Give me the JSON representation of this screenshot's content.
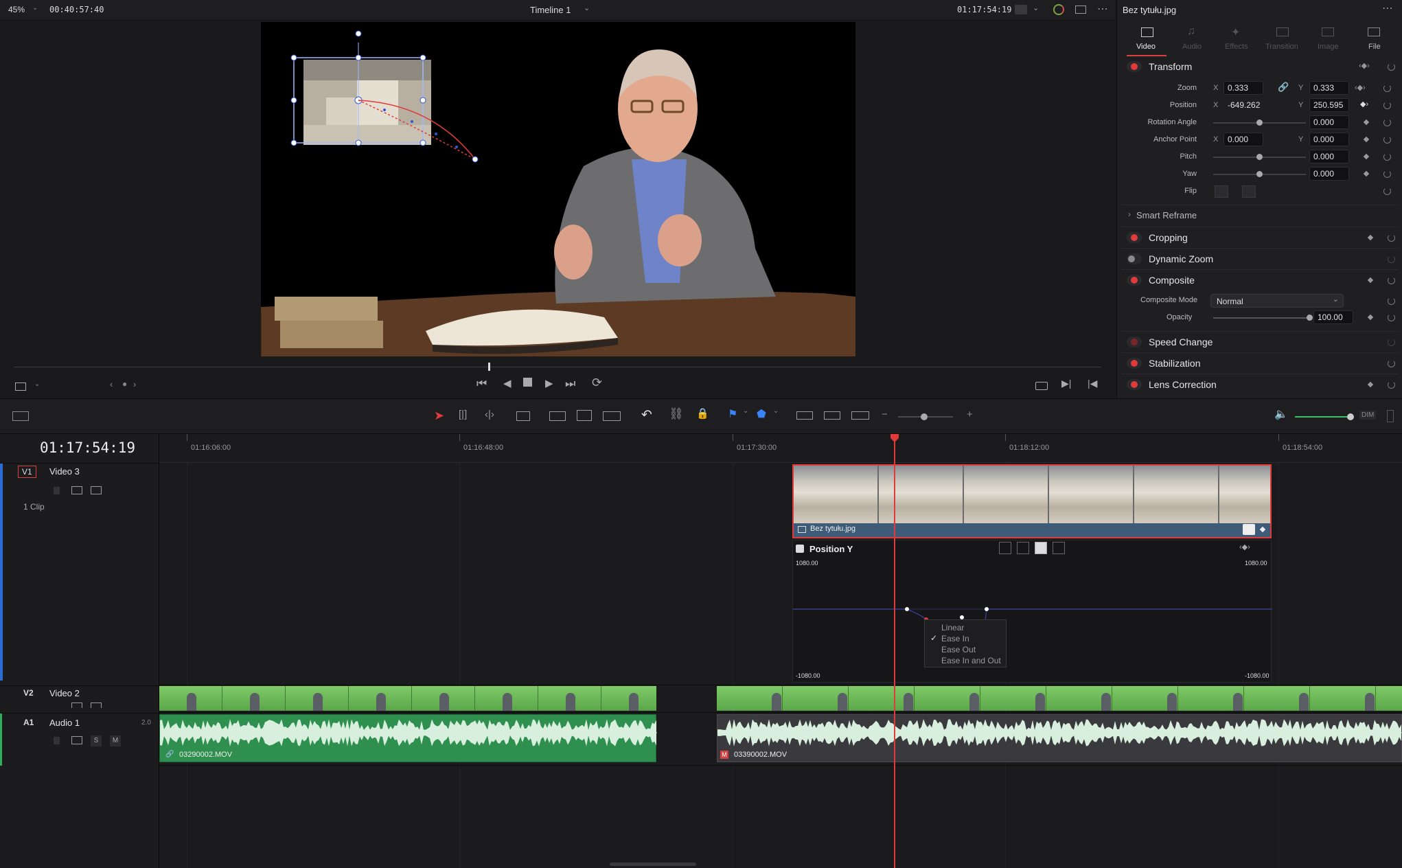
{
  "viewer": {
    "zoom": "45%",
    "source_timecode": "00:40:57:40",
    "timeline_name": "Timeline 1",
    "record_timecode": "01:17:54:19"
  },
  "inspector": {
    "clip_name": "Bez tytułu.jpg",
    "tabs": [
      {
        "label": "Video",
        "icon": "video-icon"
      },
      {
        "label": "Audio",
        "icon": "audio-icon"
      },
      {
        "label": "Effects",
        "icon": "effects-icon"
      },
      {
        "label": "Transition",
        "icon": "transition-icon"
      },
      {
        "label": "Image",
        "icon": "image-icon"
      },
      {
        "label": "File",
        "icon": "file-icon"
      }
    ],
    "transform": {
      "title": "Transform",
      "zoom_label": "Zoom",
      "zoom_x": "0.333",
      "zoom_y": "0.333",
      "position_label": "Position",
      "position_x": "-649.262",
      "position_y": "250.595",
      "rotation_label": "Rotation Angle",
      "rotation": "0.000",
      "anchor_label": "Anchor Point",
      "anchor_x": "0.000",
      "anchor_y": "0.000",
      "pitch_label": "Pitch",
      "pitch": "0.000",
      "yaw_label": "Yaw",
      "yaw": "0.000",
      "flip_label": "Flip",
      "x_axis": "X",
      "y_axis": "Y"
    },
    "smart_reframe": "Smart Reframe",
    "cropping": "Cropping",
    "dynamic_zoom": "Dynamic Zoom",
    "composite": {
      "title": "Composite",
      "mode_label": "Composite Mode",
      "mode_value": "Normal",
      "opacity_label": "Opacity",
      "opacity_value": "100.00"
    },
    "speed_change": "Speed Change",
    "stabilization": "Stabilization",
    "lens_correction": "Lens Correction"
  },
  "timeline": {
    "timecode": "01:17:54:19",
    "ruler": [
      "01:16:06:00",
      "01:16:48:00",
      "01:17:30:00",
      "01:18:12:00",
      "01:18:54:00"
    ],
    "tracks": {
      "v3": {
        "tag": "V1",
        "name": "Video 3",
        "clips_count": "1 Clip"
      },
      "v2": {
        "tag": "V2",
        "name": "Video 2"
      },
      "a1": {
        "tag": "A1",
        "name": "Audio 1",
        "channels": "2.0",
        "solo": "S",
        "mute": "M"
      }
    },
    "image_clip_name": "Bez tytułu.jpg",
    "curve_editor": {
      "title": "Position Y",
      "max_label_left": "1080.00",
      "max_label_right": "1080.00",
      "min_label_left": "-1080.00",
      "min_label_right": "-1080.00"
    },
    "context_menu": {
      "items": [
        "Linear",
        "Ease In",
        "Ease Out",
        "Ease In and Out"
      ],
      "checked": "Ease In"
    },
    "audio_clips": [
      "03290002.MOV",
      "03390002.MOV"
    ],
    "audio_volume_label": "DIM"
  }
}
